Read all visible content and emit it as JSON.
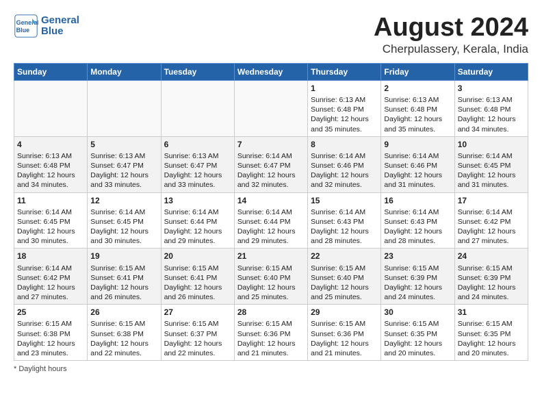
{
  "header": {
    "logo_line1": "General",
    "logo_line2": "Blue",
    "month_year": "August 2024",
    "location": "Cherpulassery, Kerala, India"
  },
  "days_of_week": [
    "Sunday",
    "Monday",
    "Tuesday",
    "Wednesday",
    "Thursday",
    "Friday",
    "Saturday"
  ],
  "weeks": [
    [
      {
        "day": "",
        "info": ""
      },
      {
        "day": "",
        "info": ""
      },
      {
        "day": "",
        "info": ""
      },
      {
        "day": "",
        "info": ""
      },
      {
        "day": "1",
        "info": "Sunrise: 6:13 AM\nSunset: 6:48 PM\nDaylight: 12 hours\nand 35 minutes."
      },
      {
        "day": "2",
        "info": "Sunrise: 6:13 AM\nSunset: 6:48 PM\nDaylight: 12 hours\nand 35 minutes."
      },
      {
        "day": "3",
        "info": "Sunrise: 6:13 AM\nSunset: 6:48 PM\nDaylight: 12 hours\nand 34 minutes."
      }
    ],
    [
      {
        "day": "4",
        "info": "Sunrise: 6:13 AM\nSunset: 6:48 PM\nDaylight: 12 hours\nand 34 minutes."
      },
      {
        "day": "5",
        "info": "Sunrise: 6:13 AM\nSunset: 6:47 PM\nDaylight: 12 hours\nand 33 minutes."
      },
      {
        "day": "6",
        "info": "Sunrise: 6:13 AM\nSunset: 6:47 PM\nDaylight: 12 hours\nand 33 minutes."
      },
      {
        "day": "7",
        "info": "Sunrise: 6:14 AM\nSunset: 6:47 PM\nDaylight: 12 hours\nand 32 minutes."
      },
      {
        "day": "8",
        "info": "Sunrise: 6:14 AM\nSunset: 6:46 PM\nDaylight: 12 hours\nand 32 minutes."
      },
      {
        "day": "9",
        "info": "Sunrise: 6:14 AM\nSunset: 6:46 PM\nDaylight: 12 hours\nand 31 minutes."
      },
      {
        "day": "10",
        "info": "Sunrise: 6:14 AM\nSunset: 6:45 PM\nDaylight: 12 hours\nand 31 minutes."
      }
    ],
    [
      {
        "day": "11",
        "info": "Sunrise: 6:14 AM\nSunset: 6:45 PM\nDaylight: 12 hours\nand 30 minutes."
      },
      {
        "day": "12",
        "info": "Sunrise: 6:14 AM\nSunset: 6:45 PM\nDaylight: 12 hours\nand 30 minutes."
      },
      {
        "day": "13",
        "info": "Sunrise: 6:14 AM\nSunset: 6:44 PM\nDaylight: 12 hours\nand 29 minutes."
      },
      {
        "day": "14",
        "info": "Sunrise: 6:14 AM\nSunset: 6:44 PM\nDaylight: 12 hours\nand 29 minutes."
      },
      {
        "day": "15",
        "info": "Sunrise: 6:14 AM\nSunset: 6:43 PM\nDaylight: 12 hours\nand 28 minutes."
      },
      {
        "day": "16",
        "info": "Sunrise: 6:14 AM\nSunset: 6:43 PM\nDaylight: 12 hours\nand 28 minutes."
      },
      {
        "day": "17",
        "info": "Sunrise: 6:14 AM\nSunset: 6:42 PM\nDaylight: 12 hours\nand 27 minutes."
      }
    ],
    [
      {
        "day": "18",
        "info": "Sunrise: 6:14 AM\nSunset: 6:42 PM\nDaylight: 12 hours\nand 27 minutes."
      },
      {
        "day": "19",
        "info": "Sunrise: 6:15 AM\nSunset: 6:41 PM\nDaylight: 12 hours\nand 26 minutes."
      },
      {
        "day": "20",
        "info": "Sunrise: 6:15 AM\nSunset: 6:41 PM\nDaylight: 12 hours\nand 26 minutes."
      },
      {
        "day": "21",
        "info": "Sunrise: 6:15 AM\nSunset: 6:40 PM\nDaylight: 12 hours\nand 25 minutes."
      },
      {
        "day": "22",
        "info": "Sunrise: 6:15 AM\nSunset: 6:40 PM\nDaylight: 12 hours\nand 25 minutes."
      },
      {
        "day": "23",
        "info": "Sunrise: 6:15 AM\nSunset: 6:39 PM\nDaylight: 12 hours\nand 24 minutes."
      },
      {
        "day": "24",
        "info": "Sunrise: 6:15 AM\nSunset: 6:39 PM\nDaylight: 12 hours\nand 24 minutes."
      }
    ],
    [
      {
        "day": "25",
        "info": "Sunrise: 6:15 AM\nSunset: 6:38 PM\nDaylight: 12 hours\nand 23 minutes."
      },
      {
        "day": "26",
        "info": "Sunrise: 6:15 AM\nSunset: 6:38 PM\nDaylight: 12 hours\nand 22 minutes."
      },
      {
        "day": "27",
        "info": "Sunrise: 6:15 AM\nSunset: 6:37 PM\nDaylight: 12 hours\nand 22 minutes."
      },
      {
        "day": "28",
        "info": "Sunrise: 6:15 AM\nSunset: 6:36 PM\nDaylight: 12 hours\nand 21 minutes."
      },
      {
        "day": "29",
        "info": "Sunrise: 6:15 AM\nSunset: 6:36 PM\nDaylight: 12 hours\nand 21 minutes."
      },
      {
        "day": "30",
        "info": "Sunrise: 6:15 AM\nSunset: 6:35 PM\nDaylight: 12 hours\nand 20 minutes."
      },
      {
        "day": "31",
        "info": "Sunrise: 6:15 AM\nSunset: 6:35 PM\nDaylight: 12 hours\nand 20 minutes."
      }
    ]
  ],
  "footnote": "* Daylight hours"
}
